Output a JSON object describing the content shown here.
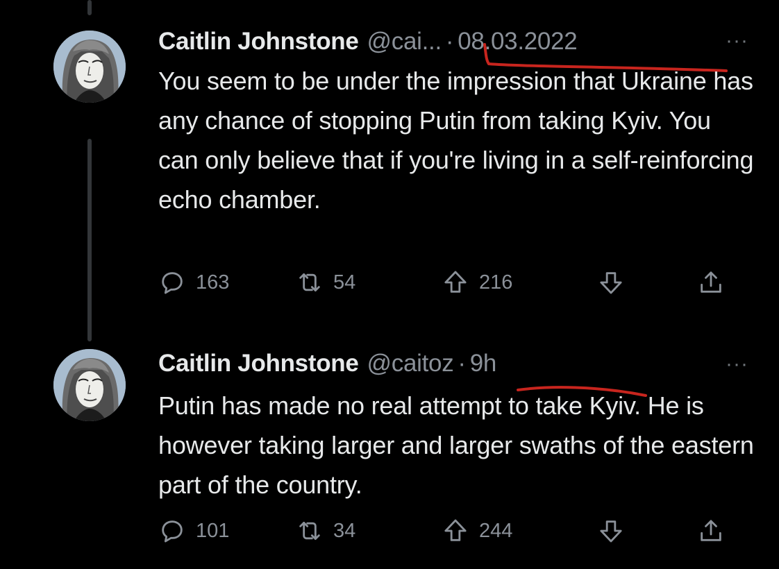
{
  "tweets": [
    {
      "author": "Caitlin Johnstone",
      "handle": "@cai...",
      "separator": "·",
      "time": "08.03.2022",
      "more": "···",
      "text": "You seem to be under the impression that Ukraine has any chance of stopping Putin from taking Kyiv. You can only believe that if you're living in a self-reinforcing echo chamber.",
      "replies": "163",
      "retweets": "54",
      "upvotes": "216"
    },
    {
      "author": "Caitlin Johnstone",
      "handle": "@caitoz",
      "separator": "·",
      "time": "9h",
      "more": "···",
      "text": "Putin has made no real attempt to take Kyiv. He is however taking larger and larger swaths of the eastern part of the country.",
      "replies": "101",
      "retweets": "34",
      "upvotes": "244"
    }
  ],
  "colors": {
    "background": "#000000",
    "text": "#e7e9ea",
    "muted": "#8b9199",
    "thread_line": "#333639",
    "annotation": "#c8251e"
  },
  "icons": [
    "avatar",
    "reply-icon",
    "retweet-icon",
    "upvote-icon",
    "downvote-icon",
    "share-icon",
    "more-icon"
  ]
}
